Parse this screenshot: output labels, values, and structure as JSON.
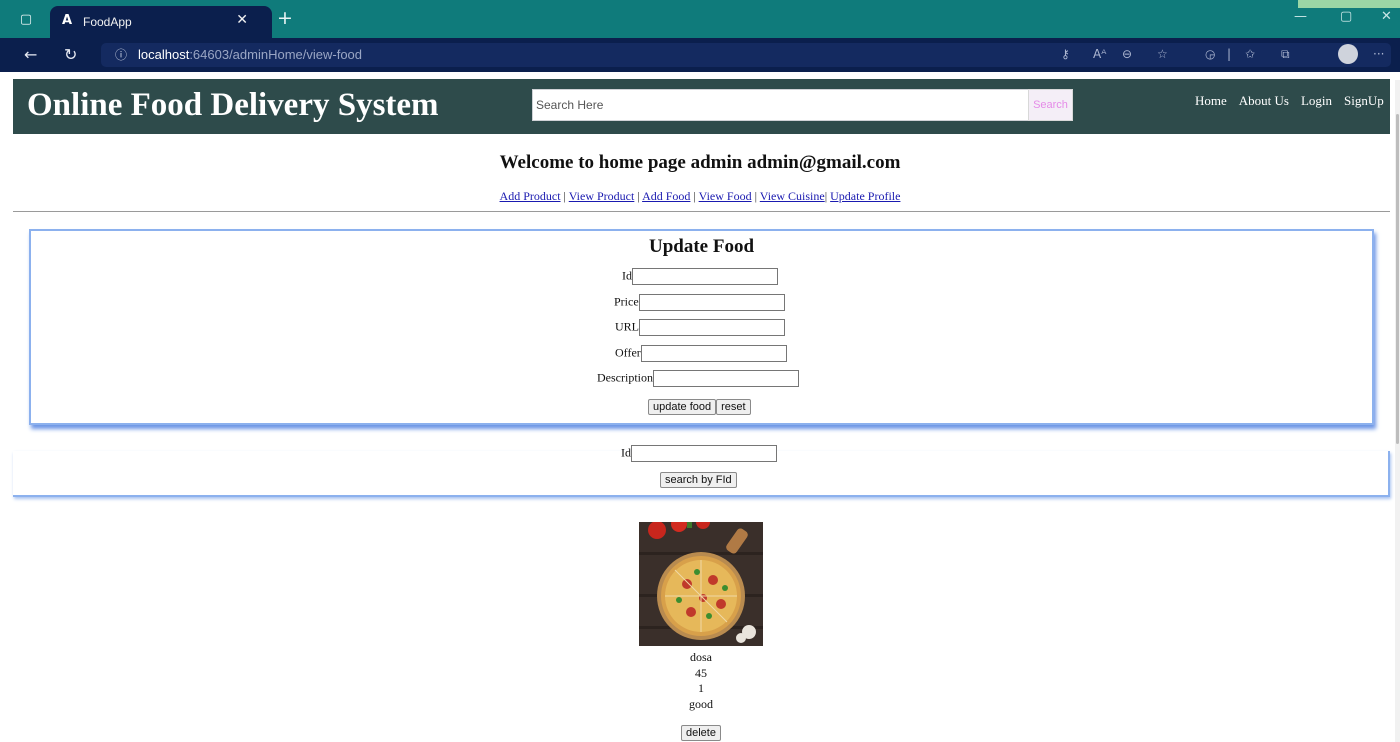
{
  "browser": {
    "tab_title": "FoodApp",
    "tab_icon": "A",
    "url_host": "localhost",
    "url_rest": ":64603/adminHome/view-food",
    "theme_color": "#0f7b7b",
    "toolbar_color": "#0b1f4d"
  },
  "header": {
    "title": "Online Food Delivery System",
    "search_placeholder": "Search Here",
    "search_button": "Search",
    "nav": [
      "Home",
      "About Us",
      "Login",
      "SignUp"
    ],
    "color": "#2e4b4b"
  },
  "welcome": "Welcome to home page admin admin@gmail.com",
  "admin_links": [
    "Add Product",
    "View Product",
    "Add Food",
    "View Food",
    "View Cuisine",
    "Update Profile"
  ],
  "update_form": {
    "title": "Update Food",
    "labels": [
      "Id",
      "Price",
      "URL",
      "Offer",
      "Description"
    ],
    "update_button": "update food",
    "reset_button": "reset"
  },
  "search_form": {
    "label": "Id",
    "button": "search by FId"
  },
  "food": {
    "name": "dosa",
    "price": "45",
    "offer": "1",
    "description": "good",
    "delete_button": "delete"
  }
}
